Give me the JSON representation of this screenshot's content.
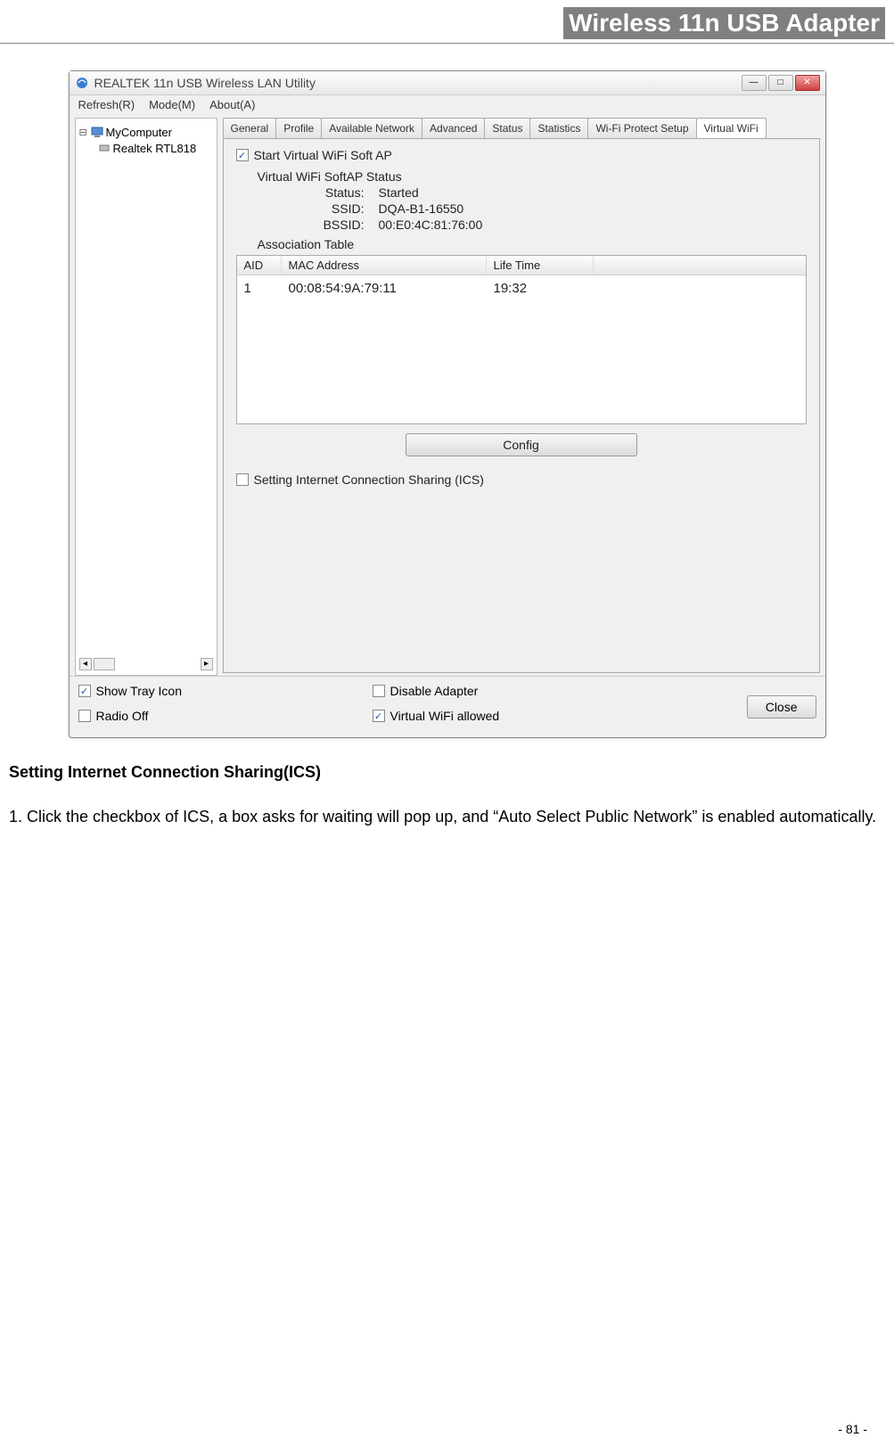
{
  "header": {
    "title": "Wireless 11n USB Adapter"
  },
  "window": {
    "title": "REALTEK 11n USB Wireless LAN Utility",
    "menus": [
      "Refresh(R)",
      "Mode(M)",
      "About(A)"
    ],
    "tree": {
      "root": "MyComputer",
      "child": "Realtek RTL818"
    },
    "tabs": [
      "General",
      "Profile",
      "Available Network",
      "Advanced",
      "Status",
      "Statistics",
      "Wi-Fi Protect Setup",
      "Virtual WiFi"
    ],
    "active_tab": "Virtual WiFi",
    "start_ap_label": "Start Virtual WiFi Soft AP",
    "start_ap_checked": true,
    "softap_status_title": "Virtual WiFi SoftAP Status",
    "status": {
      "status_label": "Status:",
      "status_val": "Started",
      "ssid_label": "SSID:",
      "ssid_val": "DQA-B1-16550",
      "bssid_label": "BSSID:",
      "bssid_val": "00:E0:4C:81:76:00"
    },
    "assoc_title": "Association Table",
    "table": {
      "headers": {
        "aid": "AID",
        "mac": "MAC Address",
        "life": "Life Time"
      },
      "rows": [
        {
          "aid": "1",
          "mac": "00:08:54:9A:79:11",
          "life": "19:32"
        }
      ]
    },
    "config_btn": "Config",
    "ics_label": "Setting Internet Connection Sharing (ICS)",
    "ics_checked": false,
    "bottom": {
      "show_tray": {
        "label": "Show Tray Icon",
        "checked": true
      },
      "radio_off": {
        "label": "Radio Off",
        "checked": false
      },
      "disable_adapter": {
        "label": "Disable Adapter",
        "checked": false
      },
      "virtual_allowed": {
        "label": "Virtual WiFi allowed",
        "checked": true
      },
      "close_btn": "Close"
    }
  },
  "doc": {
    "heading": "Setting Internet Connection Sharing(ICS)",
    "para": "1. Click the checkbox of ICS, a box asks for waiting will pop up, and “Auto Select Public Network” is enabled automatically."
  },
  "page_num": "- 81 -"
}
